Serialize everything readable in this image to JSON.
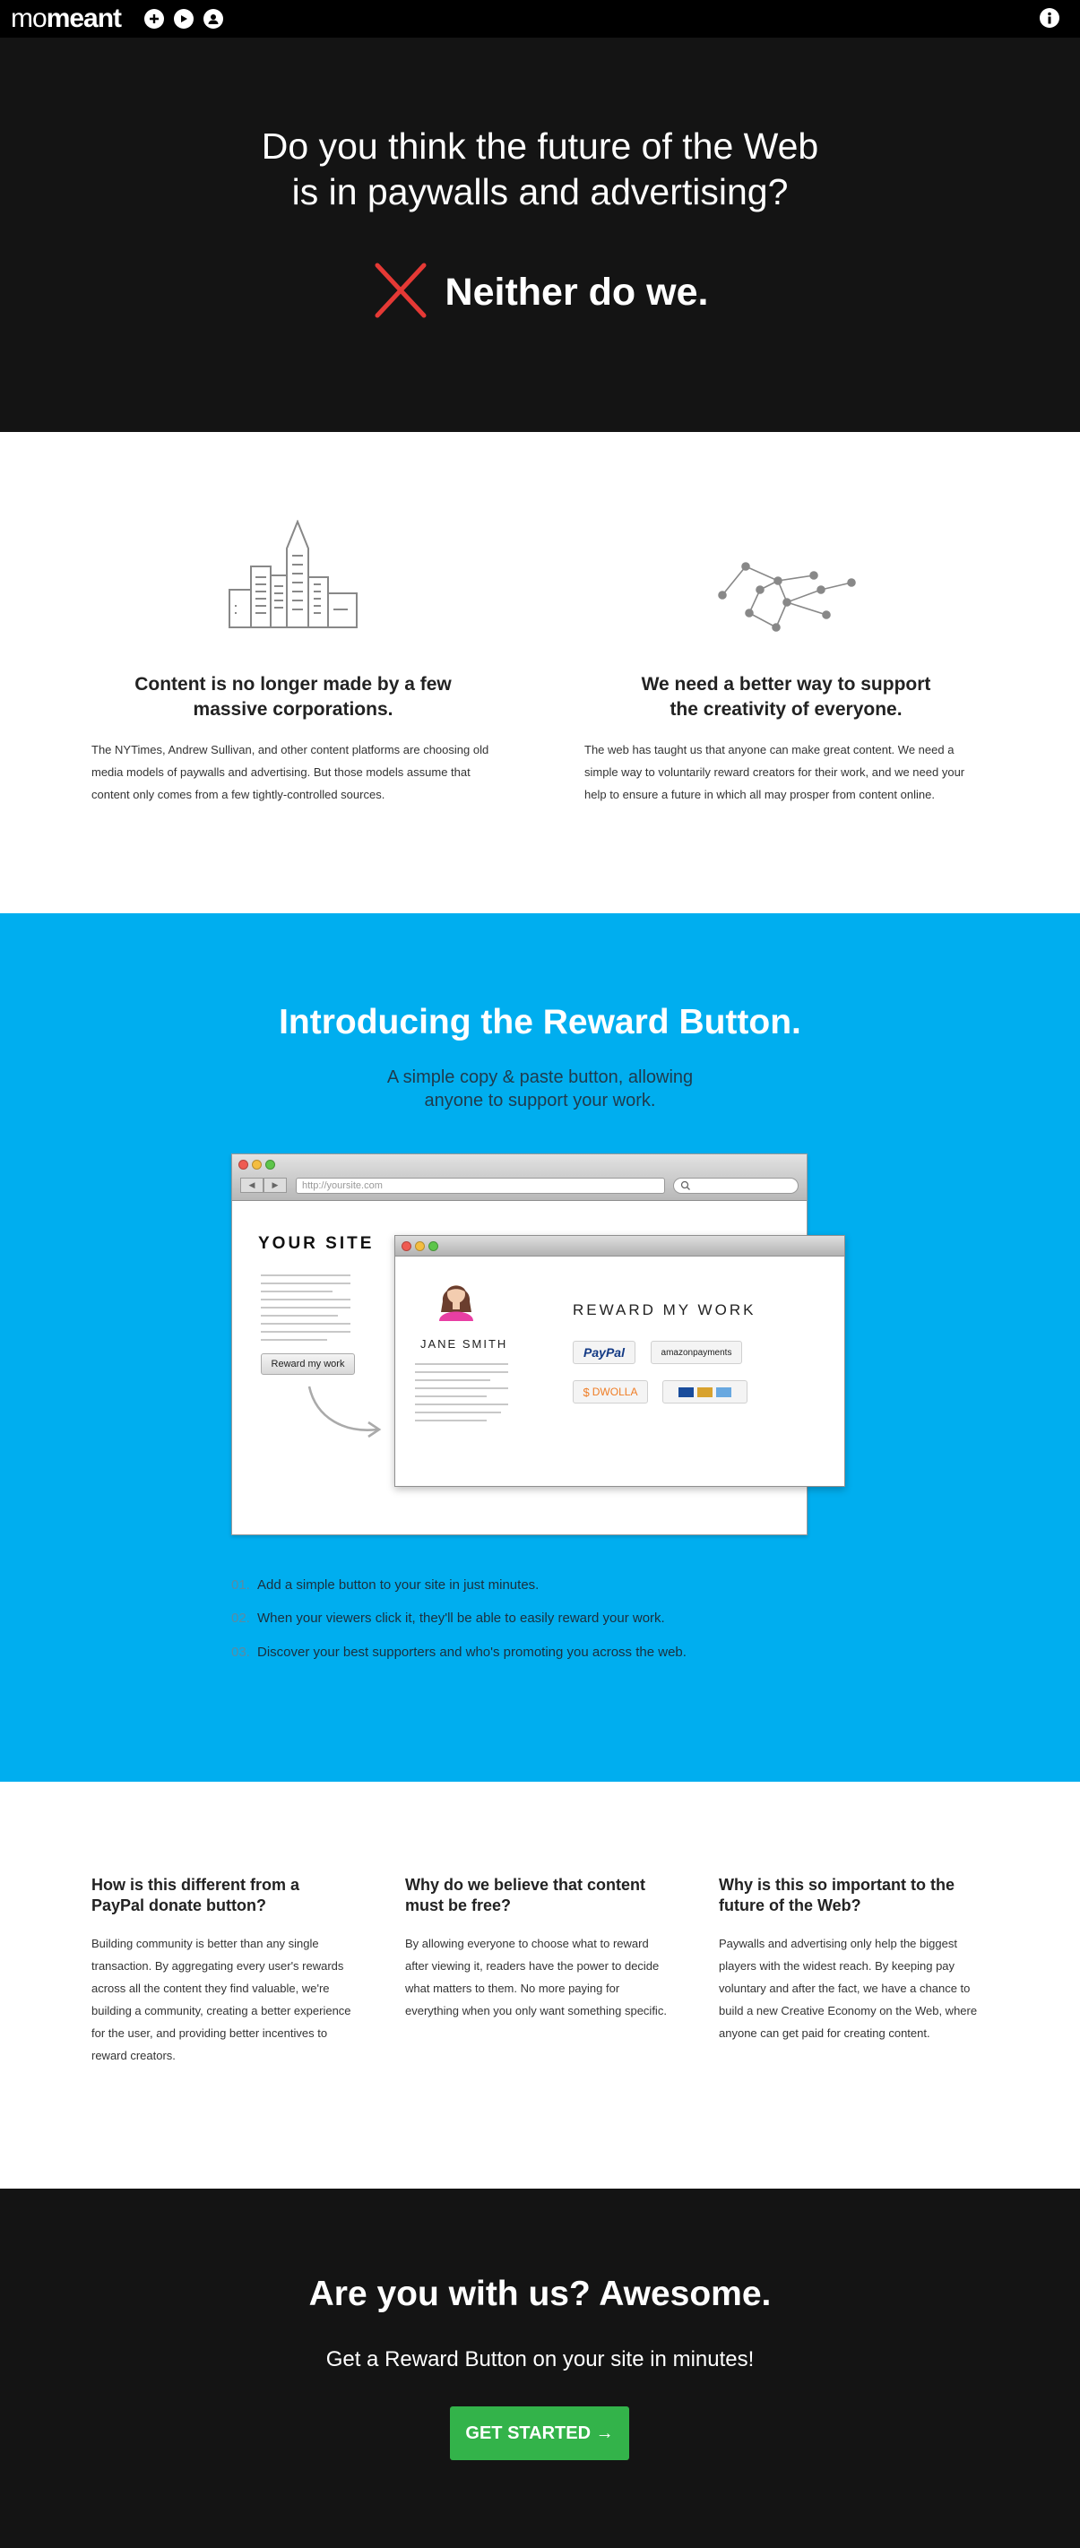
{
  "nav": {
    "logo_light": "mo",
    "logo_bold": "meant",
    "icons": [
      "plus-circle-icon",
      "play-circle-icon",
      "user-circle-icon",
      "info-circle-icon"
    ]
  },
  "hero": {
    "question_line1": "Do you think the future of the Web",
    "question_line2": "is in paywalls and advertising?",
    "answer": "Neither do we.",
    "cross_color": "#e53935"
  },
  "features": [
    {
      "icon": "city-buildings-icon",
      "title_line1": "Content is no longer made by a few",
      "title_line2": "massive corporations.",
      "body": "The NYTimes, Andrew Sullivan, and other content platforms are choosing old media models of paywalls and advertising. But those models assume that content only comes from a few tightly-controlled sources."
    },
    {
      "icon": "network-nodes-icon",
      "title_line1": "We need a better way to support",
      "title_line2": "the creativity of everyone.",
      "body": "The web has taught us that anyone can make great content. We need a simple way to voluntarily reward creators for their work, and we need your help to ensure a future in which all may prosper from content online."
    }
  ],
  "intro": {
    "title": "Introducing the Reward Button.",
    "sub_line1": "A simple copy & paste button, allowing",
    "sub_line2": "anyone to support your work.",
    "background": "#00aeef",
    "mockup": {
      "url": "http://yoursite.com",
      "your_site": "YOUR SITE",
      "reward_button": "Reward my work",
      "jane": "JANE SMITH",
      "popup_title": "REWARD MY WORK",
      "paypal": "PayPal",
      "amazon": "amazonpayments",
      "dwolla": "DWOLLA"
    },
    "steps": [
      {
        "num": "01.",
        "text": "Add a simple button to your site in just minutes."
      },
      {
        "num": "02.",
        "text": "When your viewers click it, they'll be able to easily reward your work."
      },
      {
        "num": "03.",
        "text": "Discover your best supporters and who's promoting you across the web."
      }
    ]
  },
  "faq": [
    {
      "title_line1": "How is this different from a",
      "title_line2": "PayPal donate button?",
      "body": "Building community is better than any single transaction. By aggregating every user's rewards across all the content they find valuable, we're building a community, creating a better experience for the user, and providing better incentives to reward creators."
    },
    {
      "title_line1": "Why do we believe that content",
      "title_line2": "must be free?",
      "body": "By allowing everyone to choose what to reward after viewing it, readers have the power to decide what matters to them. No more paying for everything when you only want something specific."
    },
    {
      "title_line1": "Why is this so important to the",
      "title_line2": "future of the Web?",
      "body": "Paywalls and advertising only help the biggest players with the widest reach. By keeping pay voluntary and after the fact, we have a chance to build a new Creative Economy on the Web, where anyone can get paid for creating content."
    }
  ],
  "cta": {
    "title": "Are you with us? Awesome.",
    "sub": "Get a Reward Button on your site in minutes!",
    "button": "GET STARTED →",
    "button_color": "#33b34a"
  }
}
